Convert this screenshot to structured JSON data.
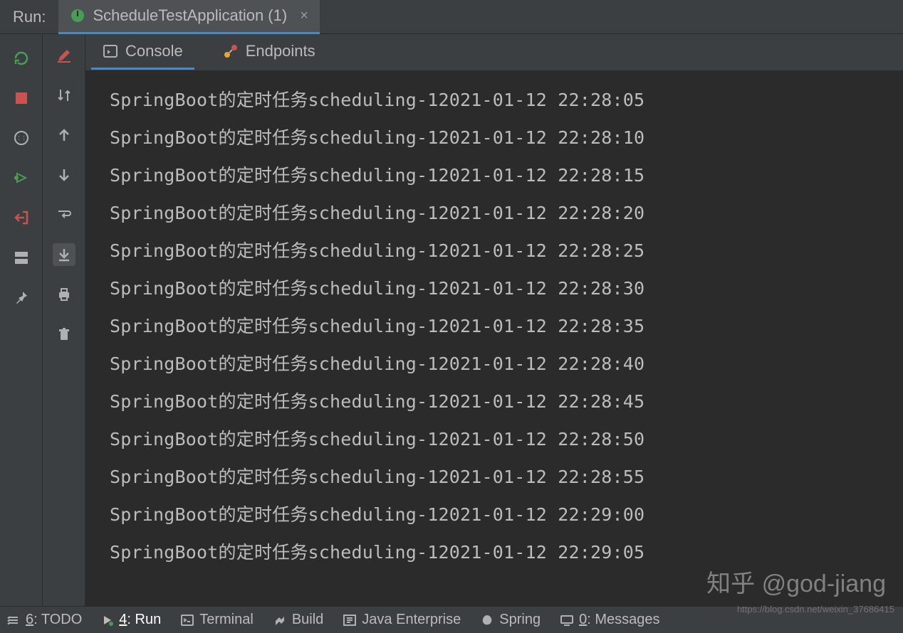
{
  "header": {
    "run_label": "Run:",
    "tab_label": "ScheduleTestApplication (1)"
  },
  "subtabs": {
    "console": "Console",
    "endpoints": "Endpoints"
  },
  "console": {
    "lines": [
      "SpringBoot的定时任务scheduling-12021-01-12 22:28:05",
      "SpringBoot的定时任务scheduling-12021-01-12 22:28:10",
      "SpringBoot的定时任务scheduling-12021-01-12 22:28:15",
      "SpringBoot的定时任务scheduling-12021-01-12 22:28:20",
      "SpringBoot的定时任务scheduling-12021-01-12 22:28:25",
      "SpringBoot的定时任务scheduling-12021-01-12 22:28:30",
      "SpringBoot的定时任务scheduling-12021-01-12 22:28:35",
      "SpringBoot的定时任务scheduling-12021-01-12 22:28:40",
      "SpringBoot的定时任务scheduling-12021-01-12 22:28:45",
      "SpringBoot的定时任务scheduling-12021-01-12 22:28:50",
      "SpringBoot的定时任务scheduling-12021-01-12 22:28:55",
      "SpringBoot的定时任务scheduling-12021-01-12 22:29:00",
      "SpringBoot的定时任务scheduling-12021-01-12 22:29:05"
    ]
  },
  "bottom": {
    "todo_prefix": "6",
    "todo_label": ": TODO",
    "run_prefix": "4",
    "run_label": ": Run",
    "terminal": "Terminal",
    "build": "Build",
    "java_enterprise": "Java Enterprise",
    "spring": "Spring",
    "messages_prefix": "0",
    "messages_label": ": Messages"
  },
  "watermark": "知乎 @god-jiang",
  "watermark_small": "https://blog.csdn.net/weixin_37686415",
  "colors": {
    "bg": "#3c3f41",
    "console_bg": "#2b2b2b",
    "accent": "#4a88c7",
    "green": "#499c54",
    "red": "#c75450"
  }
}
